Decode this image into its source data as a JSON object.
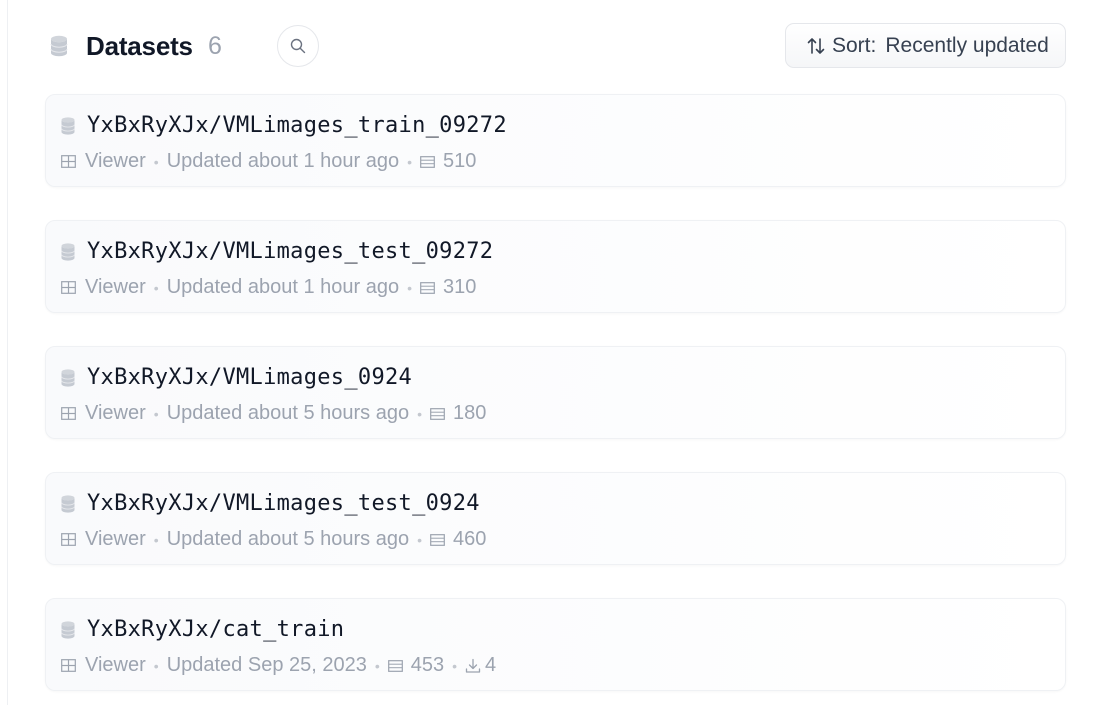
{
  "header": {
    "title": "Datasets",
    "count": "6",
    "sort_label": "Sort:",
    "sort_value": "Recently updated"
  },
  "datasets": [
    {
      "name": "YxBxRyXJx/VMLimages_train_09272",
      "viewer": "Viewer",
      "updated": "Updated about 1 hour ago",
      "rows": "510"
    },
    {
      "name": "YxBxRyXJx/VMLimages_test_09272",
      "viewer": "Viewer",
      "updated": "Updated about 1 hour ago",
      "rows": "310"
    },
    {
      "name": "YxBxRyXJx/VMLimages_0924",
      "viewer": "Viewer",
      "updated": "Updated about 5 hours ago",
      "rows": "180"
    },
    {
      "name": "YxBxRyXJx/VMLimages_test_0924",
      "viewer": "Viewer",
      "updated": "Updated about 5 hours ago",
      "rows": "460"
    },
    {
      "name": "YxBxRyXJx/cat_train",
      "viewer": "Viewer",
      "updated": "Updated Sep 25, 2023",
      "rows": "453",
      "downloads": "4"
    }
  ],
  "icons": {
    "header": "database-icon",
    "search": "search-icon",
    "sort": "sort-arrows-icon",
    "viewer": "table-icon",
    "rows": "rows-icon",
    "downloads": "download-icon"
  },
  "colors": {
    "text": "#111827",
    "muted": "#9ca3af",
    "border": "#e5e7eb"
  }
}
